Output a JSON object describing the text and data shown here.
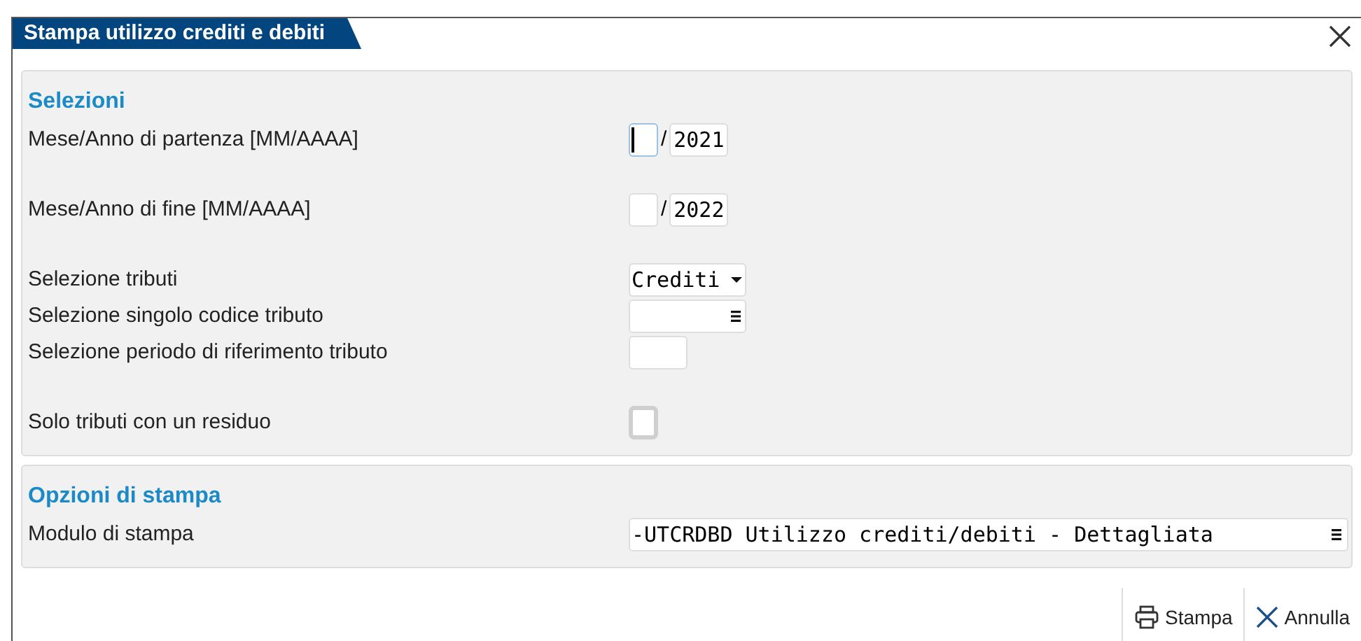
{
  "window": {
    "title": "Stampa utilizzo crediti e debiti"
  },
  "sections": [
    {
      "title": "Selezioni",
      "fields": [
        {
          "kind": "month_year",
          "label": "Mese/Anno di partenza [MM/AAAA]",
          "separator": "/",
          "year": "2021",
          "focused": true
        },
        {
          "kind": "month_year",
          "label": "Mese/Anno di fine [MM/AAAA]",
          "separator": "/",
          "year": "2022",
          "focused": false
        },
        {
          "kind": "dropdown",
          "label": "Selezione tributi",
          "value": "Crediti"
        },
        {
          "kind": "lookup",
          "label": "Selezione singolo codice tributo"
        },
        {
          "kind": "text",
          "label": "Selezione periodo di riferimento tributo"
        },
        {
          "kind": "checkbox",
          "label": "Solo tributi con un residuo",
          "checked": false
        }
      ]
    },
    {
      "title": "Opzioni di stampa",
      "fields": [
        {
          "kind": "lookup_wide",
          "label": "Modulo di stampa",
          "value": "-UTCRDBD Utilizzo crediti/debiti - Dettagliata"
        }
      ]
    }
  ],
  "buttons": [
    {
      "kind": "print",
      "label": "Stampa"
    },
    {
      "kind": "cancel",
      "label": "Annulla"
    }
  ]
}
